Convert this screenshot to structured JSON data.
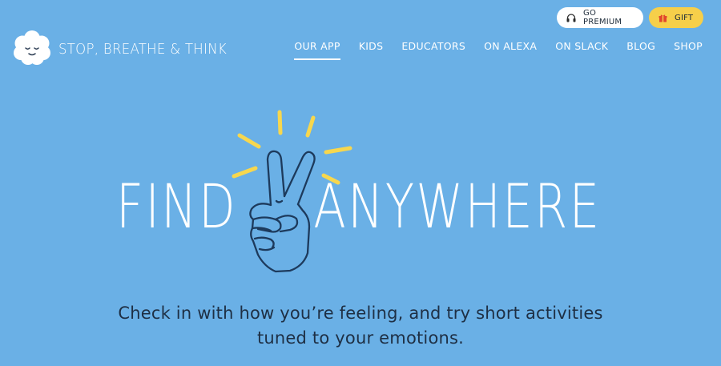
{
  "header": {
    "brand": "STOP, BREATHE & THINK",
    "premium_label": "GO PREMIUM",
    "gift_label": "GIFT",
    "nav": [
      {
        "label": "OUR APP",
        "active": true
      },
      {
        "label": "KIDS"
      },
      {
        "label": "EDUCATORS"
      },
      {
        "label": "ON ALEXA"
      },
      {
        "label": "ON SLACK"
      },
      {
        "label": "BLOG"
      },
      {
        "label": "SHOP"
      }
    ]
  },
  "hero": {
    "word_left": "FIND",
    "word_right": "ANYWHERE",
    "subtext_line1": "Check in with how you’re feeling, and try short activities",
    "subtext_line2": "tuned to your emotions."
  },
  "icons": {
    "logo": "cloud-face-icon",
    "premium": "headphones-icon",
    "gift": "gift-icon",
    "hero": "peace-sign-hand-icon"
  },
  "colors": {
    "background": "#6ab0e6",
    "gift_button": "#f6cf4a",
    "accent_rays": "#f7d74e",
    "body_text": "#1e2f44"
  }
}
